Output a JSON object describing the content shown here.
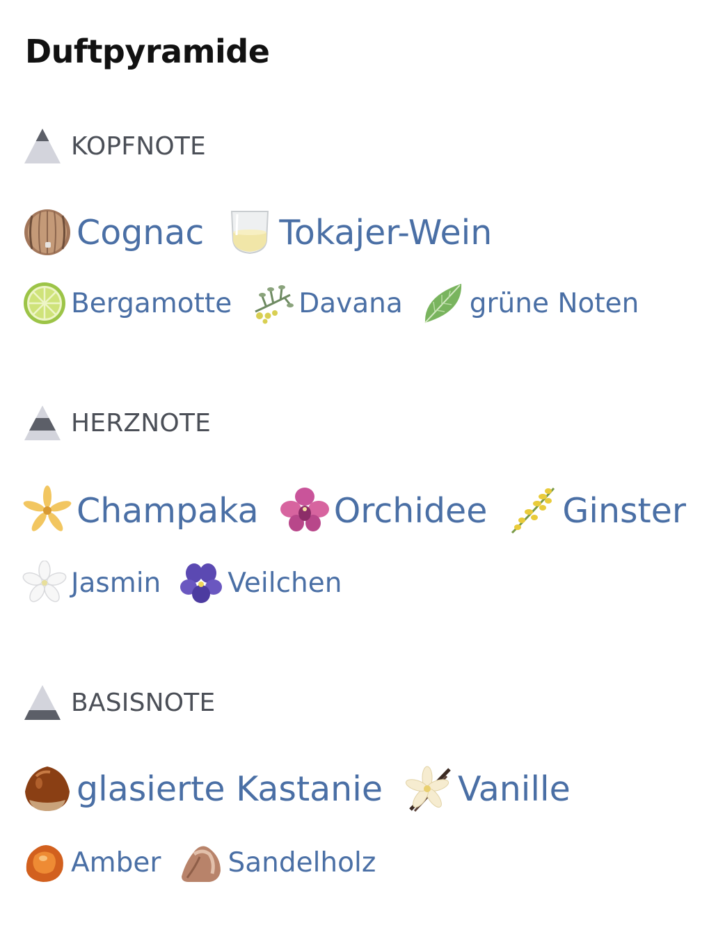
{
  "title": "Duftpyramide",
  "colors": {
    "note_text": "#4a6fa5",
    "tier_label": "#4b4f57",
    "title": "#111111"
  },
  "tiers": [
    {
      "label": "KOPFNOTE",
      "icon": "pyramid-top-icon",
      "primary": [
        {
          "name": "Cognac",
          "icon": "barrel-icon"
        },
        {
          "name": "Tokajer-Wein",
          "icon": "wine-glass-icon"
        }
      ],
      "secondary": [
        {
          "name": "Bergamotte",
          "icon": "citrus-slice-icon"
        },
        {
          "name": "Davana",
          "icon": "davana-herb-icon"
        },
        {
          "name": "grüne Noten",
          "icon": "green-leaf-icon"
        }
      ]
    },
    {
      "label": "HERZNOTE",
      "icon": "pyramid-middle-icon",
      "primary": [
        {
          "name": "Champaka",
          "icon": "champaka-flower-icon"
        },
        {
          "name": "Orchidee",
          "icon": "orchid-icon"
        },
        {
          "name": "Ginster",
          "icon": "broom-flower-icon"
        }
      ],
      "secondary": [
        {
          "name": "Jasmin",
          "icon": "jasmine-flower-icon"
        },
        {
          "name": "Veilchen",
          "icon": "violet-flower-icon"
        }
      ]
    },
    {
      "label": "BASISNOTE",
      "icon": "pyramid-base-icon",
      "primary": [
        {
          "name": "glasierte Kastanie",
          "icon": "chestnut-icon"
        },
        {
          "name": "Vanille",
          "icon": "vanilla-icon"
        }
      ],
      "secondary": [
        {
          "name": "Amber",
          "icon": "amber-icon"
        },
        {
          "name": "Sandelholz",
          "icon": "sandalwood-icon"
        }
      ]
    }
  ]
}
